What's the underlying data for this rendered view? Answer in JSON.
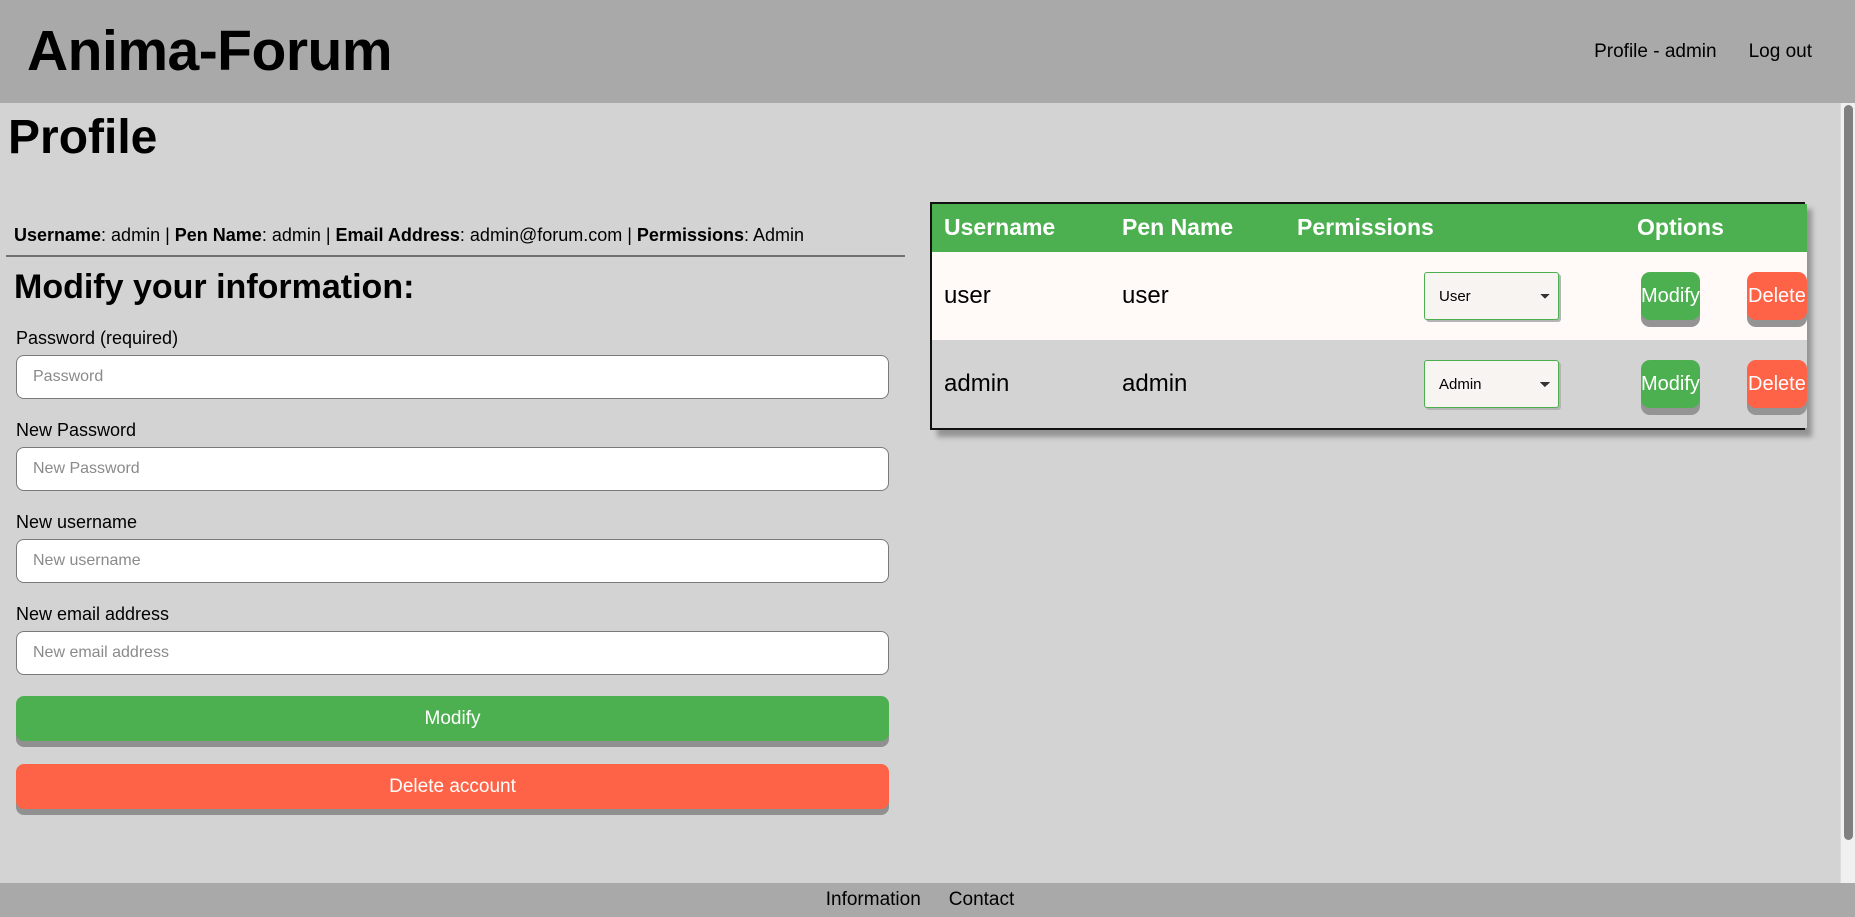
{
  "header": {
    "brand": "Anima-Forum",
    "nav": [
      {
        "label": "Profile - admin"
      },
      {
        "label": "Log out"
      }
    ]
  },
  "main": {
    "page_title": "Profile",
    "profile_summary": {
      "username_label": "Username",
      "username_value": ": admin | ",
      "penname_label": "Pen Name",
      "penname_value": ": admin | ",
      "email_label": "Email Address",
      "email_value": ": admin@forum.com | ",
      "permissions_label": "Permissions",
      "permissions_value": ": Admin"
    },
    "form": {
      "title": "Modify your information:",
      "fields": [
        {
          "label": "Password (required)",
          "placeholder": "Password",
          "value": ""
        },
        {
          "label": "New Password",
          "placeholder": "New Password",
          "value": ""
        },
        {
          "label": "New username",
          "placeholder": "New username",
          "value": ""
        },
        {
          "label": "New email address",
          "placeholder": "New email address",
          "value": ""
        }
      ],
      "submit_label": "Modify",
      "delete_label": "Delete account"
    }
  },
  "admin_table": {
    "columns": [
      "Username",
      "Pen Name",
      "Permissions",
      "Options"
    ],
    "permission_options": [
      "User",
      "Admin"
    ],
    "rows": [
      {
        "username": "user",
        "pen_name": "user",
        "permission": "User",
        "modify_label": "Modify",
        "delete_label": "Delete"
      },
      {
        "username": "admin",
        "pen_name": "admin",
        "permission": "Admin",
        "modify_label": "Modify",
        "delete_label": "Delete"
      }
    ]
  },
  "footer": {
    "links": [
      {
        "label": "Information"
      },
      {
        "label": "Contact"
      }
    ]
  },
  "colors": {
    "header_bg": "#a9a9a9",
    "body_bg": "#d3d3d3",
    "accent_green": "#4cb050",
    "accent_red": "#ff6347",
    "row_odd": "#fffaf8",
    "row_even": "#d3d3d3"
  }
}
